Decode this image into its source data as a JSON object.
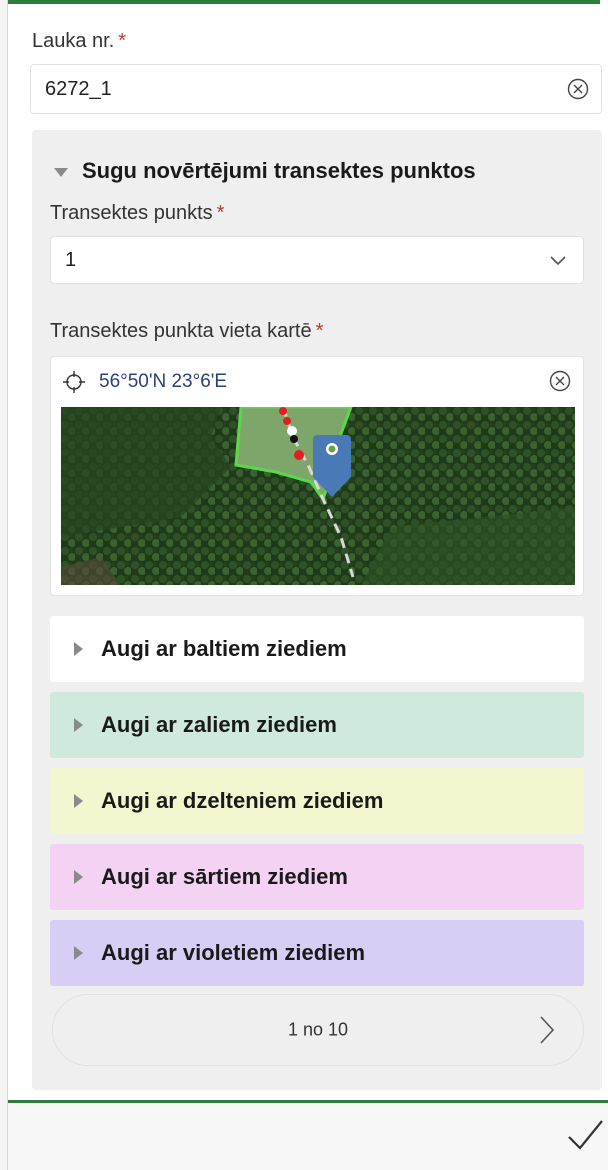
{
  "field_lauka": {
    "label": "Lauka nr.",
    "required": "*",
    "value": "6272_1"
  },
  "section": {
    "title": "Sugu novērtējumi transektes punktos"
  },
  "transektes_punkts": {
    "label": "Transektes punkts",
    "required": "*",
    "value": "1"
  },
  "map_field": {
    "label": "Transektes punkta vieta kartē",
    "required": "*",
    "coords": "56°50'N 23°6'E"
  },
  "groups": [
    {
      "label": "Augi ar baltiem ziediem",
      "color": "#ffffff"
    },
    {
      "label": "Augi ar zaliem ziediem",
      "color": "#cfeadc"
    },
    {
      "label": "Augi ar dzelteniem ziediem",
      "color": "#f4f6cf"
    },
    {
      "label": "Augi ar sārtiem ziediem",
      "color": "#f3d2f3"
    },
    {
      "label": "Augi ar violetiem ziediem",
      "color": "#d8cef5"
    }
  ],
  "pager": {
    "text": "1 no 10"
  },
  "colors": {
    "accent_green": "#2f7d3b",
    "required_red": "#c0392b",
    "coord_blue": "#2c3f7a"
  }
}
